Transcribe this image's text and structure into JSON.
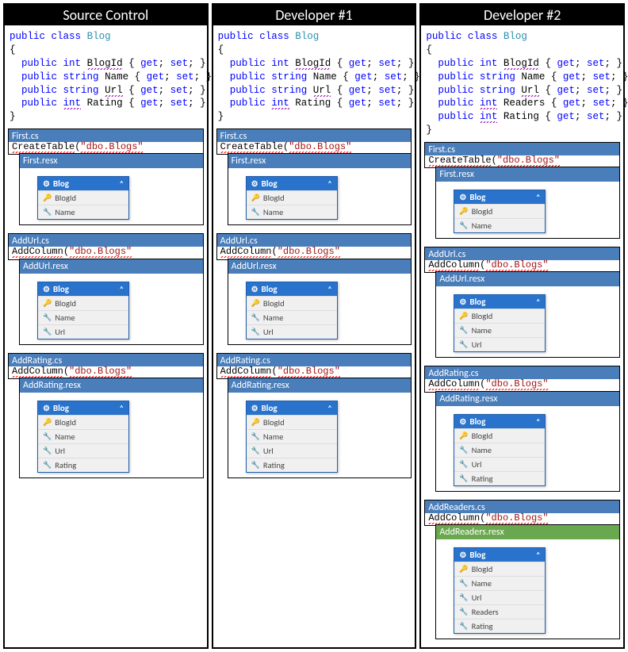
{
  "columns": [
    {
      "title": "Source Control",
      "code": [
        {
          "tokens": [
            {
              "t": "public",
              "c": "kw"
            },
            {
              "t": " "
            },
            {
              "t": "class",
              "c": "kw"
            },
            {
              "t": " "
            },
            {
              "t": "Blog",
              "c": "type"
            }
          ]
        },
        {
          "tokens": [
            {
              "t": "{",
              "c": "brace"
            }
          ]
        },
        {
          "tokens": [
            {
              "t": "  "
            },
            {
              "t": "public",
              "c": "kw"
            },
            {
              "t": " "
            },
            {
              "t": "int",
              "c": "kw"
            },
            {
              "t": " "
            },
            {
              "t": "BlogId",
              "c": "ident",
              "u": "squiggle-purple"
            },
            {
              "t": " { "
            },
            {
              "t": "get",
              "c": "kw"
            },
            {
              "t": "; "
            },
            {
              "t": "set",
              "c": "kw"
            },
            {
              "t": "; }"
            }
          ]
        },
        {
          "tokens": [
            {
              "t": "  "
            },
            {
              "t": "public",
              "c": "kw"
            },
            {
              "t": " "
            },
            {
              "t": "string",
              "c": "kw"
            },
            {
              "t": " Name { "
            },
            {
              "t": "get",
              "c": "kw"
            },
            {
              "t": "; "
            },
            {
              "t": "set",
              "c": "kw"
            },
            {
              "t": "; }"
            }
          ]
        },
        {
          "tokens": [
            {
              "t": "  "
            },
            {
              "t": "public",
              "c": "kw"
            },
            {
              "t": " "
            },
            {
              "t": "string",
              "c": "kw"
            },
            {
              "t": " "
            },
            {
              "t": "Url",
              "c": "ident",
              "u": "squiggle-purple"
            },
            {
              "t": " { "
            },
            {
              "t": "get",
              "c": "kw"
            },
            {
              "t": "; "
            },
            {
              "t": "set",
              "c": "kw"
            },
            {
              "t": "; }"
            }
          ]
        },
        {
          "tokens": [
            {
              "t": "  "
            },
            {
              "t": "public",
              "c": "kw"
            },
            {
              "t": " "
            },
            {
              "t": "int",
              "c": "kw",
              "u": "squiggle-purple"
            },
            {
              "t": " Rating { "
            },
            {
              "t": "get",
              "c": "kw"
            },
            {
              "t": "; "
            },
            {
              "t": "set",
              "c": "kw"
            },
            {
              "t": "; }"
            }
          ]
        },
        {
          "tokens": [
            {
              "t": "}",
              "c": "brace"
            }
          ]
        }
      ],
      "migrations": [
        {
          "cs": "First.cs",
          "cs_bg": "blue",
          "call": "CreateTable",
          "arg": "\"dbo.Blogs\"",
          "resx": "First.resx",
          "resx_bg": "blue",
          "entity": "Blog",
          "fields": [
            {
              "n": "BlogId",
              "pk": true
            },
            {
              "n": "Name"
            }
          ]
        },
        {
          "cs": "AddUrl.cs",
          "cs_bg": "blue",
          "call": "AddColumn",
          "arg": "\"dbo.Blogs\"",
          "resx": "AddUrl.resx",
          "resx_bg": "blue",
          "entity": "Blog",
          "fields": [
            {
              "n": "BlogId",
              "pk": true
            },
            {
              "n": "Name"
            },
            {
              "n": "Url"
            }
          ]
        },
        {
          "cs": "AddRating.cs",
          "cs_bg": "blue",
          "call": "AddColumn",
          "arg": "\"dbo.Blogs\"",
          "resx": "AddRating.resx",
          "resx_bg": "blue",
          "entity": "Blog",
          "fields": [
            {
              "n": "BlogId",
              "pk": true
            },
            {
              "n": "Name"
            },
            {
              "n": "Url"
            },
            {
              "n": "Rating"
            }
          ]
        }
      ]
    },
    {
      "title": "Developer #1",
      "code": [
        {
          "tokens": [
            {
              "t": "public",
              "c": "kw"
            },
            {
              "t": " "
            },
            {
              "t": "class",
              "c": "kw"
            },
            {
              "t": " "
            },
            {
              "t": "Blog",
              "c": "type"
            }
          ]
        },
        {
          "tokens": [
            {
              "t": "{",
              "c": "brace"
            }
          ]
        },
        {
          "tokens": [
            {
              "t": "  "
            },
            {
              "t": "public",
              "c": "kw"
            },
            {
              "t": " "
            },
            {
              "t": "int",
              "c": "kw"
            },
            {
              "t": " "
            },
            {
              "t": "BlogId",
              "c": "ident",
              "u": "squiggle-purple"
            },
            {
              "t": " { "
            },
            {
              "t": "get",
              "c": "kw"
            },
            {
              "t": "; "
            },
            {
              "t": "set",
              "c": "kw"
            },
            {
              "t": "; }"
            }
          ]
        },
        {
          "tokens": [
            {
              "t": "  "
            },
            {
              "t": "public",
              "c": "kw"
            },
            {
              "t": " "
            },
            {
              "t": "string",
              "c": "kw"
            },
            {
              "t": " Name { "
            },
            {
              "t": "get",
              "c": "kw"
            },
            {
              "t": "; "
            },
            {
              "t": "set",
              "c": "kw"
            },
            {
              "t": "; }"
            }
          ]
        },
        {
          "tokens": [
            {
              "t": "  "
            },
            {
              "t": "public",
              "c": "kw"
            },
            {
              "t": " "
            },
            {
              "t": "string",
              "c": "kw"
            },
            {
              "t": " "
            },
            {
              "t": "Url",
              "c": "ident",
              "u": "squiggle-purple"
            },
            {
              "t": " { "
            },
            {
              "t": "get",
              "c": "kw"
            },
            {
              "t": "; "
            },
            {
              "t": "set",
              "c": "kw"
            },
            {
              "t": "; }"
            }
          ]
        },
        {
          "tokens": [
            {
              "t": "  "
            },
            {
              "t": "public",
              "c": "kw"
            },
            {
              "t": " "
            },
            {
              "t": "int",
              "c": "kw",
              "u": "squiggle-purple"
            },
            {
              "t": " Rating { "
            },
            {
              "t": "get",
              "c": "kw"
            },
            {
              "t": "; "
            },
            {
              "t": "set",
              "c": "kw"
            },
            {
              "t": "; }"
            }
          ]
        },
        {
          "tokens": [
            {
              "t": "}",
              "c": "brace"
            }
          ]
        }
      ],
      "migrations": [
        {
          "cs": "First.cs",
          "cs_bg": "blue",
          "call": "CreateTable",
          "arg": "\"dbo.Blogs\"",
          "resx": "First.resx",
          "resx_bg": "blue",
          "entity": "Blog",
          "fields": [
            {
              "n": "BlogId",
              "pk": true
            },
            {
              "n": "Name"
            }
          ]
        },
        {
          "cs": "AddUrl.cs",
          "cs_bg": "blue",
          "call": "AddColumn",
          "arg": "\"dbo.Blogs\"",
          "resx": "AddUrl.resx",
          "resx_bg": "blue",
          "entity": "Blog",
          "fields": [
            {
              "n": "BlogId",
              "pk": true
            },
            {
              "n": "Name"
            },
            {
              "n": "Url"
            }
          ]
        },
        {
          "cs": "AddRating.cs",
          "cs_bg": "blue",
          "call": "AddColumn",
          "arg": "\"dbo.Blogs\"",
          "resx": "AddRating.resx",
          "resx_bg": "blue",
          "entity": "Blog",
          "fields": [
            {
              "n": "BlogId",
              "pk": true
            },
            {
              "n": "Name"
            },
            {
              "n": "Url"
            },
            {
              "n": "Rating"
            }
          ]
        }
      ]
    },
    {
      "title": "Developer #2",
      "code": [
        {
          "tokens": [
            {
              "t": "public",
              "c": "kw"
            },
            {
              "t": " "
            },
            {
              "t": "class",
              "c": "kw"
            },
            {
              "t": " "
            },
            {
              "t": "Blog",
              "c": "type"
            }
          ]
        },
        {
          "tokens": [
            {
              "t": "{",
              "c": "brace"
            }
          ]
        },
        {
          "tokens": [
            {
              "t": "  "
            },
            {
              "t": "public",
              "c": "kw"
            },
            {
              "t": " "
            },
            {
              "t": "int",
              "c": "kw"
            },
            {
              "t": " "
            },
            {
              "t": "BlogId",
              "c": "ident",
              "u": "squiggle-purple"
            },
            {
              "t": " { "
            },
            {
              "t": "get",
              "c": "kw"
            },
            {
              "t": "; "
            },
            {
              "t": "set",
              "c": "kw"
            },
            {
              "t": "; }"
            }
          ]
        },
        {
          "tokens": [
            {
              "t": "  "
            },
            {
              "t": "public",
              "c": "kw"
            },
            {
              "t": " "
            },
            {
              "t": "string",
              "c": "kw"
            },
            {
              "t": " Name { "
            },
            {
              "t": "get",
              "c": "kw"
            },
            {
              "t": "; "
            },
            {
              "t": "set",
              "c": "kw"
            },
            {
              "t": "; }"
            }
          ]
        },
        {
          "tokens": [
            {
              "t": "  "
            },
            {
              "t": "public",
              "c": "kw"
            },
            {
              "t": " "
            },
            {
              "t": "string",
              "c": "kw"
            },
            {
              "t": " "
            },
            {
              "t": "Url",
              "c": "ident",
              "u": "squiggle-purple"
            },
            {
              "t": " { "
            },
            {
              "t": "get",
              "c": "kw"
            },
            {
              "t": "; "
            },
            {
              "t": "set",
              "c": "kw"
            },
            {
              "t": "; }"
            }
          ]
        },
        {
          "tokens": [
            {
              "t": "  "
            },
            {
              "t": "public",
              "c": "kw"
            },
            {
              "t": " "
            },
            {
              "t": "int",
              "c": "kw",
              "u": "squiggle-purple"
            },
            {
              "t": " Readers { "
            },
            {
              "t": "get",
              "c": "kw"
            },
            {
              "t": "; "
            },
            {
              "t": "set",
              "c": "kw"
            },
            {
              "t": "; }"
            }
          ]
        },
        {
          "tokens": [
            {
              "t": "  "
            },
            {
              "t": "public",
              "c": "kw"
            },
            {
              "t": " "
            },
            {
              "t": "int",
              "c": "kw",
              "u": "squiggle-purple"
            },
            {
              "t": " Rating { "
            },
            {
              "t": "get",
              "c": "kw"
            },
            {
              "t": "; "
            },
            {
              "t": "set",
              "c": "kw"
            },
            {
              "t": "; }"
            }
          ]
        },
        {
          "tokens": [
            {
              "t": "}",
              "c": "brace"
            }
          ]
        }
      ],
      "migrations": [
        {
          "cs": "First.cs",
          "cs_bg": "blue",
          "call": "CreateTable",
          "arg": "\"dbo.Blogs\"",
          "resx": "First.resx",
          "resx_bg": "blue",
          "entity": "Blog",
          "fields": [
            {
              "n": "BlogId",
              "pk": true
            },
            {
              "n": "Name"
            }
          ]
        },
        {
          "cs": "AddUrl.cs",
          "cs_bg": "blue",
          "call": "AddColumn",
          "arg": "\"dbo.Blogs\"",
          "resx": "AddUrl.resx",
          "resx_bg": "blue",
          "entity": "Blog",
          "fields": [
            {
              "n": "BlogId",
              "pk": true
            },
            {
              "n": "Name"
            },
            {
              "n": "Url"
            }
          ]
        },
        {
          "cs": "AddRating.cs",
          "cs_bg": "blue",
          "call": "AddColumn",
          "arg": "\"dbo.Blogs\"",
          "resx": "AddRating.resx",
          "resx_bg": "blue",
          "entity": "Blog",
          "fields": [
            {
              "n": "BlogId",
              "pk": true
            },
            {
              "n": "Name"
            },
            {
              "n": "Url"
            },
            {
              "n": "Rating"
            }
          ]
        },
        {
          "cs": "AddReaders.cs",
          "cs_bg": "blue",
          "call": "AddColumn",
          "arg": "\"dbo.Blogs\"",
          "resx": "AddReaders.resx",
          "resx_bg": "green",
          "entity": "Blog",
          "fields": [
            {
              "n": "BlogId",
              "pk": true
            },
            {
              "n": "Name"
            },
            {
              "n": "Url"
            },
            {
              "n": "Readers"
            },
            {
              "n": "Rating"
            }
          ]
        }
      ]
    }
  ],
  "icons": {
    "entity": "⚙",
    "chev": "˄",
    "pk": "🔑",
    "prop": "🔧"
  }
}
